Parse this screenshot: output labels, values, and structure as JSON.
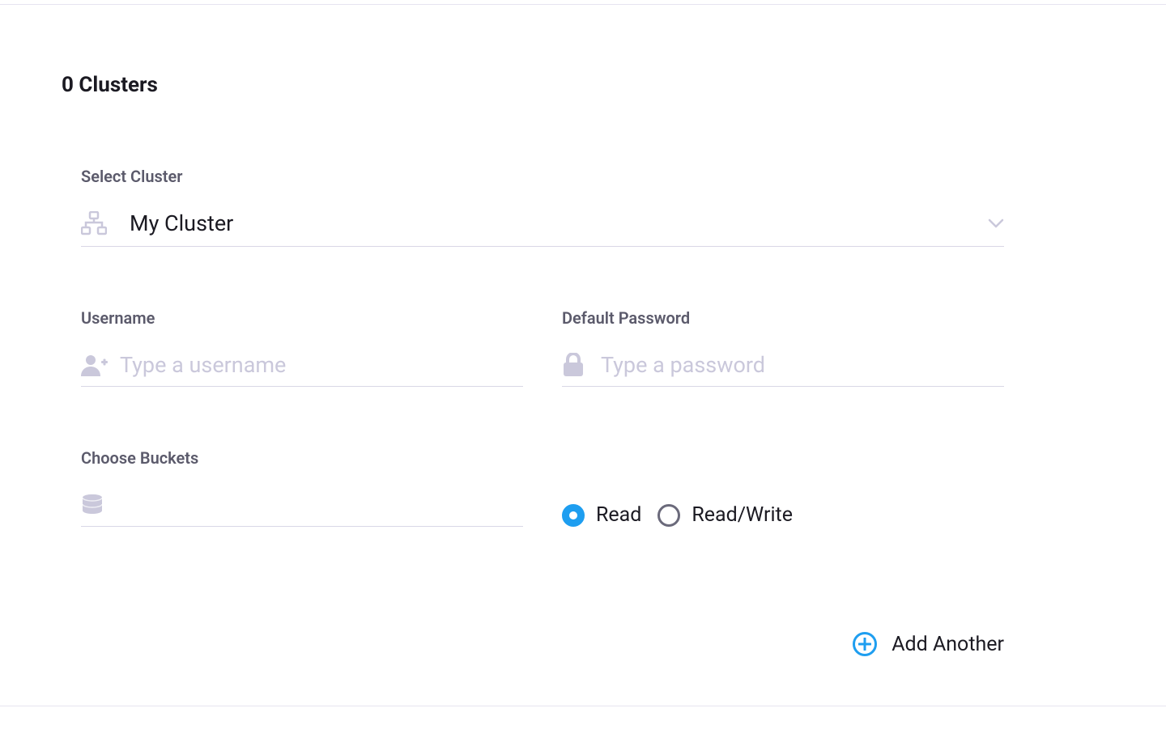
{
  "header": {
    "title": "0 Clusters"
  },
  "cluster": {
    "label": "Select Cluster",
    "value": "My Cluster"
  },
  "username": {
    "label": "Username",
    "placeholder": "Type a username",
    "value": ""
  },
  "password": {
    "label": "Default Password",
    "placeholder": "Type a password",
    "value": ""
  },
  "buckets": {
    "label": "Choose Buckets",
    "value": ""
  },
  "access": {
    "options": {
      "read": "Read",
      "readwrite": "Read/Write"
    },
    "selected": "read"
  },
  "actions": {
    "add_another": "Add Another"
  },
  "colors": {
    "accent": "#1e9ef0",
    "muted": "#cac8db",
    "label": "#5b5a6b",
    "text": "#1b1a22",
    "line": "#d9d7e6"
  }
}
